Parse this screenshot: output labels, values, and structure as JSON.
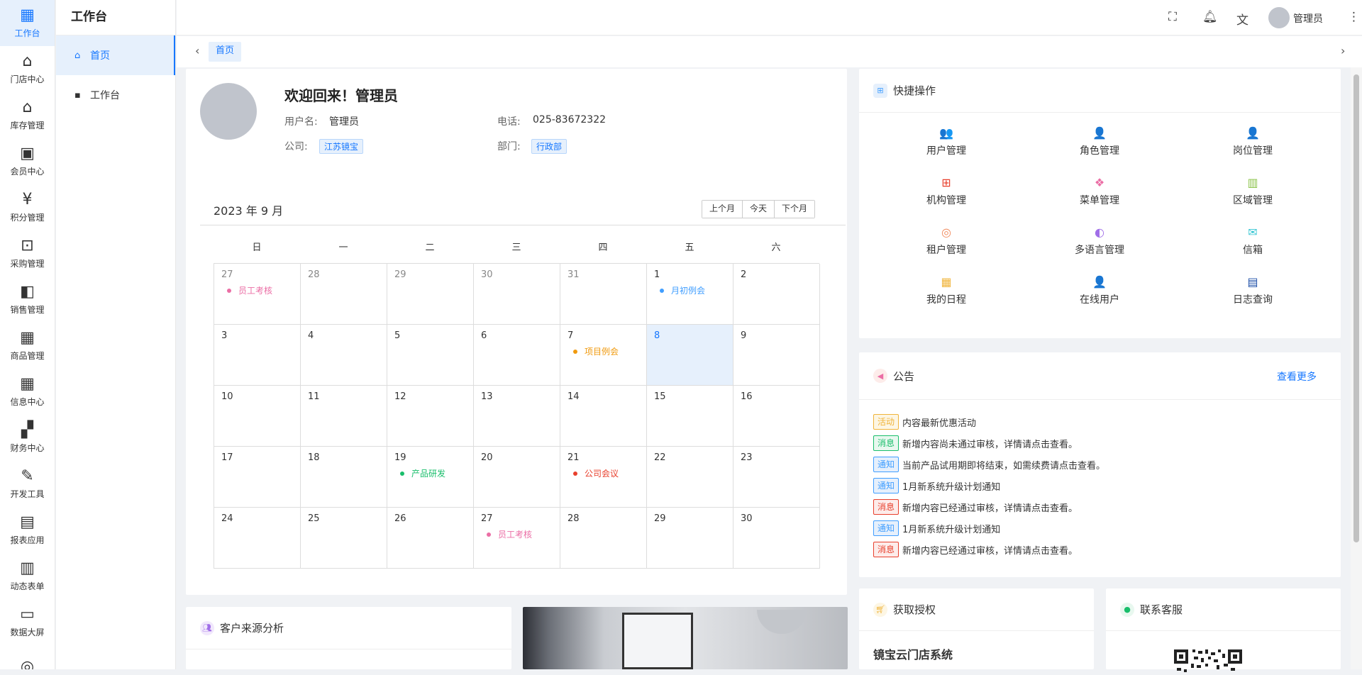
{
  "rail": [
    {
      "icon": "▦",
      "icon_name": "dashboard-icon",
      "label": "工作台"
    },
    {
      "icon": "⌂",
      "icon_name": "store-icon",
      "label": "门店中心"
    },
    {
      "icon": "⌂",
      "icon_name": "warehouse-icon",
      "label": "库存管理"
    },
    {
      "icon": "▣",
      "icon_name": "member-card-icon",
      "label": "会员中心"
    },
    {
      "icon": "¥",
      "icon_name": "points-wallet-icon",
      "label": "积分管理"
    },
    {
      "icon": "⊡",
      "icon_name": "cart-icon",
      "label": "采购管理"
    },
    {
      "icon": "◧",
      "icon_name": "shopping-bag-icon",
      "label": "销售管理"
    },
    {
      "icon": "▦",
      "icon_name": "product-grid-icon",
      "label": "商品管理"
    },
    {
      "icon": "▦",
      "icon_name": "info-grid-icon",
      "label": "信息中心"
    },
    {
      "icon": "▞",
      "icon_name": "finance-icon",
      "label": "财务中心"
    },
    {
      "icon": "✎",
      "icon_name": "dev-tools-icon",
      "label": "开发工具"
    },
    {
      "icon": "▤",
      "icon_name": "report-icon",
      "label": "报表应用"
    },
    {
      "icon": "▥",
      "icon_name": "form-icon",
      "label": "动态表单"
    },
    {
      "icon": "▭",
      "icon_name": "monitor-icon",
      "label": "数据大屏"
    },
    {
      "icon": "◎",
      "icon_name": "database-icon",
      "label": ""
    }
  ],
  "sidebar": {
    "title": "工作台",
    "items": [
      {
        "icon": "⌂",
        "label": "首页"
      },
      {
        "icon": "▪",
        "label": "工作台"
      }
    ]
  },
  "header": {
    "username": "管理员"
  },
  "tabs": {
    "active": "首页"
  },
  "profile": {
    "welcome": "欢迎回来！管理员",
    "username_label": "用户名:",
    "username_value": "管理员",
    "phone_label": "电话:",
    "phone_value": "025-83672322",
    "company_label": "公司:",
    "company_value": "江苏镜宝",
    "dept_label": "部门:",
    "dept_value": "行政部"
  },
  "calendar": {
    "title": "2023 年 9 月",
    "buttons": [
      "上个月",
      "今天",
      "下个月"
    ],
    "weekdays": [
      "日",
      "一",
      "二",
      "三",
      "四",
      "五",
      "六"
    ],
    "cells": [
      {
        "d": "27",
        "other": true,
        "event": "员工考核",
        "color": "#eb6ea5"
      },
      {
        "d": "28",
        "other": true
      },
      {
        "d": "29",
        "other": true
      },
      {
        "d": "30",
        "other": true
      },
      {
        "d": "31",
        "other": true
      },
      {
        "d": "1",
        "event": "月初例会",
        "color": "#409eff"
      },
      {
        "d": "2"
      },
      {
        "d": "3"
      },
      {
        "d": "4"
      },
      {
        "d": "5"
      },
      {
        "d": "6"
      },
      {
        "d": "7",
        "event": "项目例会",
        "color": "#f09a0e"
      },
      {
        "d": "8",
        "today": true
      },
      {
        "d": "9"
      },
      {
        "d": "10"
      },
      {
        "d": "11"
      },
      {
        "d": "12"
      },
      {
        "d": "13"
      },
      {
        "d": "14"
      },
      {
        "d": "15"
      },
      {
        "d": "16"
      },
      {
        "d": "17"
      },
      {
        "d": "18"
      },
      {
        "d": "19",
        "event": "产品研发",
        "color": "#19be6b"
      },
      {
        "d": "20"
      },
      {
        "d": "21",
        "event": "公司会议",
        "color": "#e8402d"
      },
      {
        "d": "22"
      },
      {
        "d": "23"
      },
      {
        "d": "24"
      },
      {
        "d": "25"
      },
      {
        "d": "26"
      },
      {
        "d": "27",
        "event": "员工考核",
        "color": "#eb6ea5"
      },
      {
        "d": "28"
      },
      {
        "d": "29"
      },
      {
        "d": "30"
      }
    ]
  },
  "quick": {
    "title": "快捷操作",
    "items": [
      {
        "label": "用户管理",
        "icon": "👥",
        "icon_name": "users-icon",
        "color": "#409eff"
      },
      {
        "label": "角色管理",
        "icon": "👤",
        "icon_name": "role-icon",
        "color": "#f09a0e"
      },
      {
        "label": "岗位管理",
        "icon": "👤",
        "icon_name": "position-icon",
        "color": "#19be6b"
      },
      {
        "label": "机构管理",
        "icon": "⊞",
        "icon_name": "org-icon",
        "color": "#e8402d"
      },
      {
        "label": "菜单管理",
        "icon": "❖",
        "icon_name": "menu-icon",
        "color": "#eb6ea5"
      },
      {
        "label": "区域管理",
        "icon": "▥",
        "icon_name": "region-icon",
        "color": "#8bc34a"
      },
      {
        "label": "租户管理",
        "icon": "◎",
        "icon_name": "tenant-icon",
        "color": "#f08a5d"
      },
      {
        "label": "多语言管理",
        "icon": "◐",
        "icon_name": "language-icon",
        "color": "#a06ee8"
      },
      {
        "label": "信箱",
        "icon": "✉",
        "icon_name": "mailbox-icon",
        "color": "#36c6d3"
      },
      {
        "label": "我的日程",
        "icon": "▦",
        "icon_name": "schedule-icon",
        "color": "#f0b43a"
      },
      {
        "label": "在线用户",
        "icon": "👤",
        "icon_name": "online-user-icon",
        "color": "#8d4e3a"
      },
      {
        "label": "日志查询",
        "icon": "▤",
        "icon_name": "log-icon",
        "color": "#1e4fa8"
      }
    ]
  },
  "notice": {
    "title": "公告",
    "more": "查看更多",
    "items": [
      {
        "tag": "活动",
        "tag_color": "#f0b43a",
        "tag_bg": "#fdf6e4",
        "text": "内容最新优惠活动"
      },
      {
        "tag": "消息",
        "tag_color": "#19be6b",
        "tag_bg": "#e8f8ef",
        "text": "新增内容尚未通过审核，详情请点击查看。"
      },
      {
        "tag": "通知",
        "tag_color": "#409eff",
        "tag_bg": "#e6f0fc",
        "text": "当前产品试用期即将结束，如需续费请点击查看。"
      },
      {
        "tag": "通知",
        "tag_color": "#409eff",
        "tag_bg": "#e6f0fc",
        "text": "1月新系统升级计划通知"
      },
      {
        "tag": "消息",
        "tag_color": "#e8402d",
        "tag_bg": "#fdecea",
        "text": "新增内容已经通过审核，详情请点击查看。"
      },
      {
        "tag": "通知",
        "tag_color": "#409eff",
        "tag_bg": "#e6f0fc",
        "text": "1月新系统升级计划通知"
      },
      {
        "tag": "消息",
        "tag_color": "#e8402d",
        "tag_bg": "#fdecea",
        "text": "新增内容已经通过审核，详情请点击查看。"
      }
    ]
  },
  "customer": {
    "title": "客户来源分析"
  },
  "license": {
    "title": "获取授权",
    "product": "镜宝云门店系统"
  },
  "support": {
    "title": "联系客服"
  }
}
